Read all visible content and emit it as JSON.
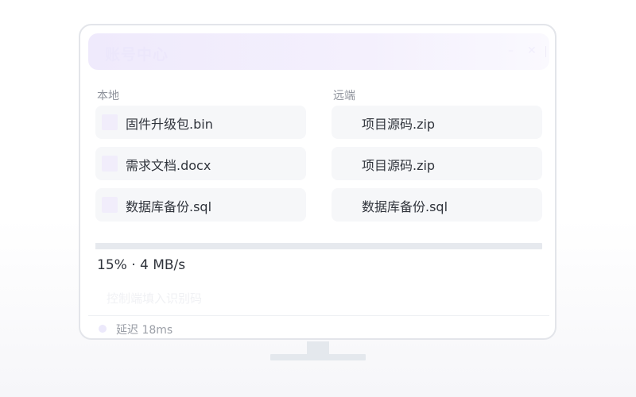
{
  "header": {
    "title": "账号中心",
    "min_icon": "minus-icon",
    "close_icon": "close-icon"
  },
  "local": {
    "label": "本地",
    "files": [
      {
        "name": "固件升级包.bin"
      },
      {
        "name": "需求文档.docx"
      },
      {
        "name": "数据库备份.sql"
      }
    ]
  },
  "remote": {
    "label": "远端",
    "files": [
      {
        "name": "项目源码.zip"
      },
      {
        "name": "项目源码.zip"
      },
      {
        "name": "数据库备份.sql"
      }
    ]
  },
  "transfer": {
    "progress_percent": 15,
    "status": "15% · 4 MB/s"
  },
  "code_input": {
    "placeholder": "控制端填入识别码",
    "value": ""
  },
  "connection": {
    "status": "延迟 18ms"
  },
  "colors": {
    "accent": "#ece7fb",
    "file_bg": "#f6f7f9",
    "track": "#e6e9ee"
  }
}
